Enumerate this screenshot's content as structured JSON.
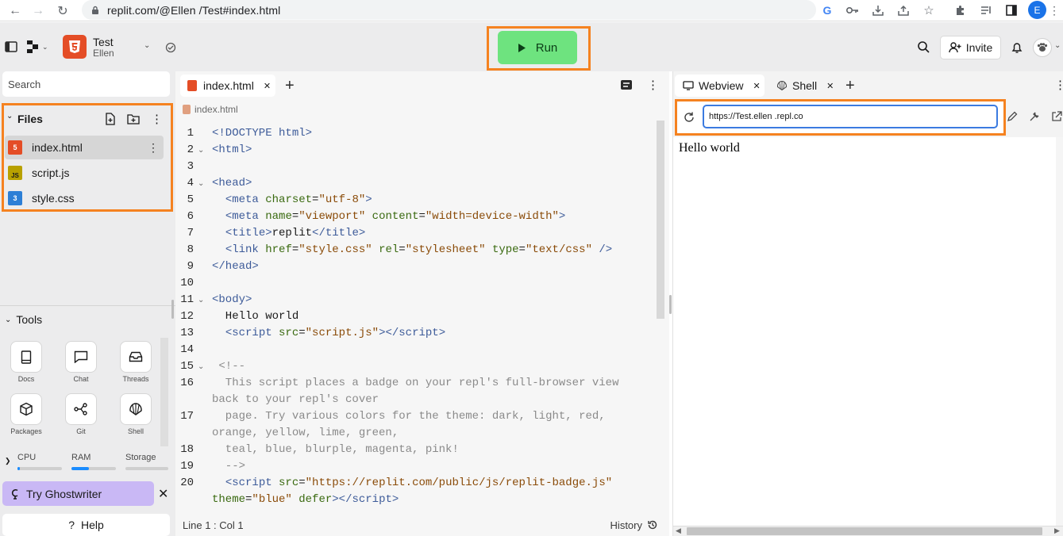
{
  "browser": {
    "url": "replit.com/@Ellen        /Test#index.html",
    "profile_initial": "E"
  },
  "header": {
    "repl_name": "Test",
    "repl_owner": "Ellen",
    "run_label": "Run",
    "invite_label": "Invite"
  },
  "sidebar": {
    "search_placeholder": "Search",
    "files_title": "Files",
    "files": [
      {
        "name": "index.html",
        "type": "html",
        "active": true
      },
      {
        "name": "script.js",
        "type": "js",
        "active": false
      },
      {
        "name": "style.css",
        "type": "css",
        "active": false
      }
    ],
    "tools_title": "Tools",
    "tools": [
      {
        "label": "Docs",
        "icon": "book-icon"
      },
      {
        "label": "Chat",
        "icon": "chat-icon"
      },
      {
        "label": "Threads",
        "icon": "inbox-icon"
      },
      {
        "label": "Packages",
        "icon": "package-icon"
      },
      {
        "label": "Git",
        "icon": "git-icon"
      },
      {
        "label": "Shell",
        "icon": "shell-icon"
      }
    ],
    "metrics": {
      "cpu_label": "CPU",
      "cpu_usage": 0.05,
      "ram_label": "RAM",
      "ram_usage": 0.4,
      "storage_label": "Storage",
      "storage_usage": 0.0
    },
    "ghostwriter_label": "Try Ghostwriter",
    "help_label": "Help"
  },
  "editor": {
    "tab_label": "index.html",
    "breadcrumb": "index.html",
    "status_position": "Line 1 : Col 1",
    "history_label": "History"
  },
  "webview": {
    "tab_webview": "Webview",
    "tab_shell": "Shell",
    "url": "https://Test.ellen        .repl.co",
    "page_text": "Hello world"
  },
  "colors": {
    "highlight_outline": "#f58220",
    "run_green": "#6ee37f",
    "ghostwriter_purple": "#c9b8f5"
  }
}
